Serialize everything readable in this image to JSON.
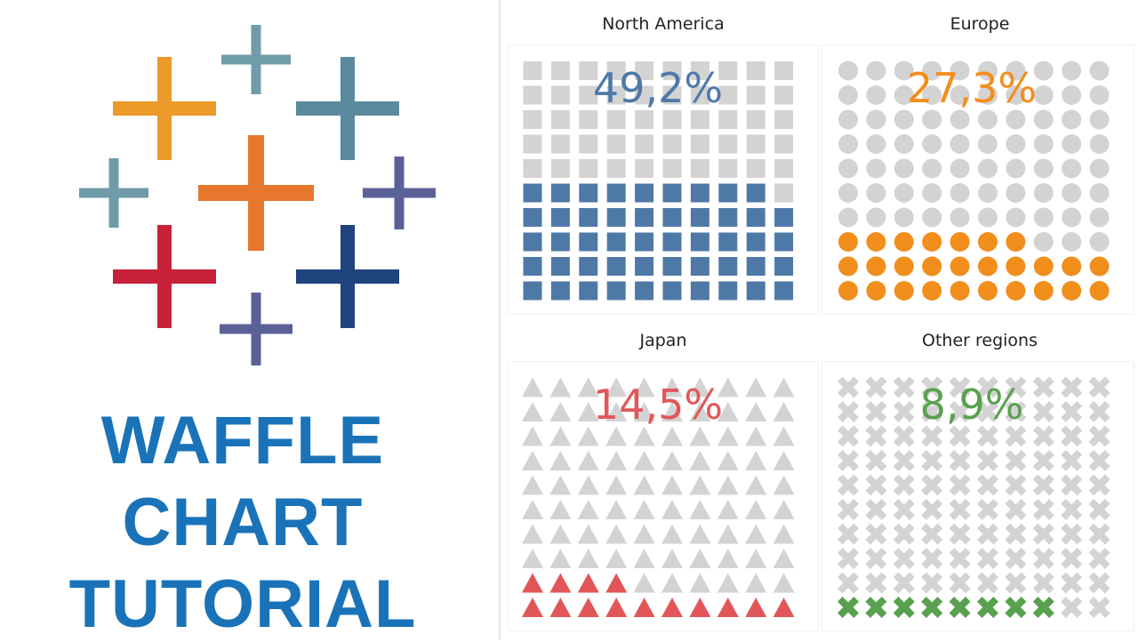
{
  "left": {
    "logo_name": "Tableau logo",
    "title_lines": [
      "WAFFLE",
      "CHART",
      "TUTORIAL"
    ],
    "title_color": "#1a73b8"
  },
  "logo_colors": {
    "top_small": "#6f9ca8",
    "top_left": "#ec9a2a",
    "top_right": "#5b8a9e",
    "mid_left_small": "#6f9ca8",
    "center": "#e8772e",
    "mid_right_small": "#5a6196",
    "bottom_left": "#c8213a",
    "bottom_right": "#1f437d",
    "bottom_small": "#5a6196"
  },
  "chart_data": [
    {
      "type": "waffle",
      "title": "North America",
      "value_label": "49,2%",
      "percent": 49.2,
      "filled_cells": 49,
      "grid": [
        10,
        10
      ],
      "shape": "square",
      "color": "#4e79a7",
      "empty_color": "#d3d3d3"
    },
    {
      "type": "waffle",
      "title": "Europe",
      "value_label": "27,3%",
      "percent": 27.3,
      "filled_cells": 27,
      "grid": [
        10,
        10
      ],
      "shape": "circle",
      "color": "#f28e1c",
      "empty_color": "#d3d3d3"
    },
    {
      "type": "waffle",
      "title": "Japan",
      "value_label": "14,5%",
      "percent": 14.5,
      "filled_cells": 14,
      "grid": [
        10,
        10
      ],
      "shape": "triangle",
      "color": "#e15759",
      "empty_color": "#d3d3d3"
    },
    {
      "type": "waffle",
      "title": "Other regions",
      "value_label": "8,9%",
      "percent": 8.9,
      "filled_cells": 8,
      "grid": [
        10,
        10
      ],
      "shape": "cross",
      "color": "#59a14f",
      "empty_color": "#d3d3d3"
    }
  ]
}
